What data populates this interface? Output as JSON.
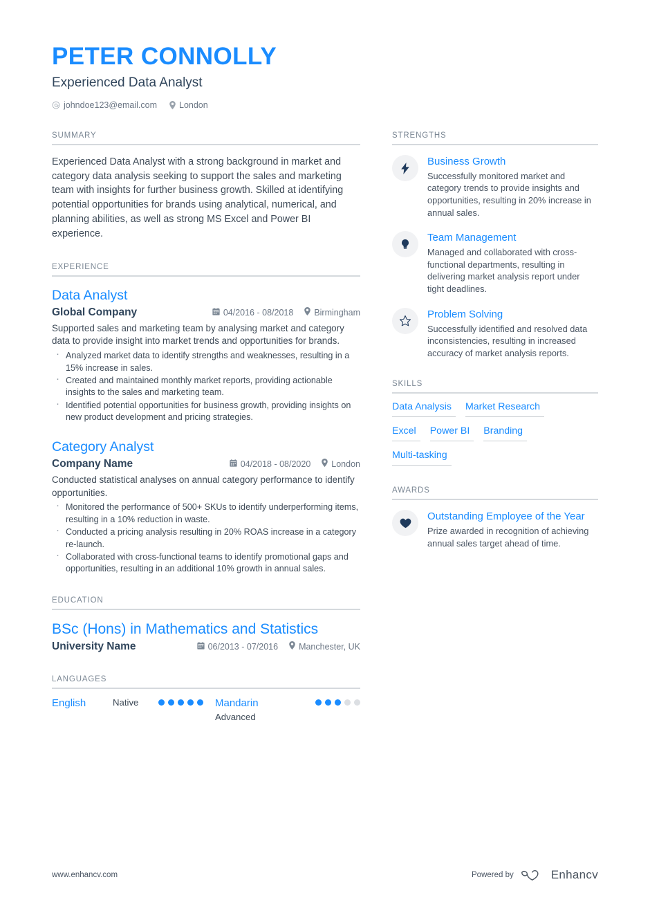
{
  "header": {
    "name": "PETER CONNOLLY",
    "job_title": "Experienced Data Analyst",
    "email": "johndoe123@email.com",
    "location": "London",
    "accent_color": "#1a8cff"
  },
  "summary": {
    "heading": "SUMMARY",
    "text": "Experienced Data Analyst with a strong background in market and category data analysis seeking to support the sales and marketing team with insights for further business growth. Skilled at identifying potential opportunities for brands using analytical, numerical, and planning abilities, as well as strong MS Excel and Power BI experience."
  },
  "experience": {
    "heading": "EXPERIENCE",
    "entries": [
      {
        "title": "Data Analyst",
        "organization": "Global Company",
        "dates": "04/2016 - 08/2018",
        "location": "Birmingham",
        "description": "Supported sales and marketing team by analysing market and category data to provide insight into market trends and opportunities for brands.",
        "bullets": [
          "Analyzed market data to identify strengths and weaknesses, resulting in a 15% increase in sales.",
          "Created and maintained monthly market reports, providing actionable insights to the sales and marketing team.",
          "Identified potential opportunities for business growth, providing insights on new product development and pricing strategies."
        ]
      },
      {
        "title": "Category Analyst",
        "organization": "Company Name",
        "dates": "04/2018 - 08/2020",
        "location": "London",
        "description": "Conducted statistical analyses on annual category performance to identify opportunities.",
        "bullets": [
          "Monitored the performance of 500+ SKUs to identify underperforming items, resulting in a 10% reduction in waste.",
          "Conducted a pricing analysis resulting in 20% ROAS increase in a category re-launch.",
          "Collaborated with cross-functional teams to identify promotional gaps and opportunities, resulting in an additional 10% growth in annual sales."
        ]
      }
    ]
  },
  "education": {
    "heading": "EDUCATION",
    "entries": [
      {
        "title": "BSc (Hons) in Mathematics and Statistics",
        "organization": "University Name",
        "dates": "06/2013 - 07/2016",
        "location": "Manchester, UK"
      }
    ]
  },
  "languages": {
    "heading": "LANGUAGES",
    "items": [
      {
        "name": "English",
        "level": "Native",
        "filled": 5,
        "total": 5
      },
      {
        "name": "Mandarin",
        "level": "Advanced",
        "filled": 3,
        "total": 5
      }
    ]
  },
  "strengths": {
    "heading": "STRENGTHS",
    "items": [
      {
        "icon": "lightning-bolt-icon",
        "name": "Business Growth",
        "description": "Successfully monitored market and category trends to provide insights and opportunities, resulting in 20% increase in annual sales."
      },
      {
        "icon": "lightbulb-icon",
        "name": "Team Management",
        "description": "Managed and collaborated with cross-functional departments, resulting in delivering market analysis report under tight deadlines."
      },
      {
        "icon": "star-outline-icon",
        "name": "Problem Solving",
        "description": "Successfully identified and resolved data inconsistencies, resulting in increased accuracy of market analysis reports."
      }
    ]
  },
  "skills": {
    "heading": "SKILLS",
    "rows": [
      [
        "Data Analysis",
        "Market Research"
      ],
      [
        "Excel",
        "Power BI",
        "Branding"
      ],
      [
        "Multi-tasking"
      ]
    ]
  },
  "awards": {
    "heading": "AWARDS",
    "items": [
      {
        "icon": "heart-icon",
        "name": "Outstanding Employee of the Year",
        "description": "Prize awarded in recognition of achieving annual sales target ahead of time."
      }
    ]
  },
  "footer": {
    "website": "www.enhancv.com",
    "powered_by": "Powered by",
    "brand": "Enhancv"
  }
}
